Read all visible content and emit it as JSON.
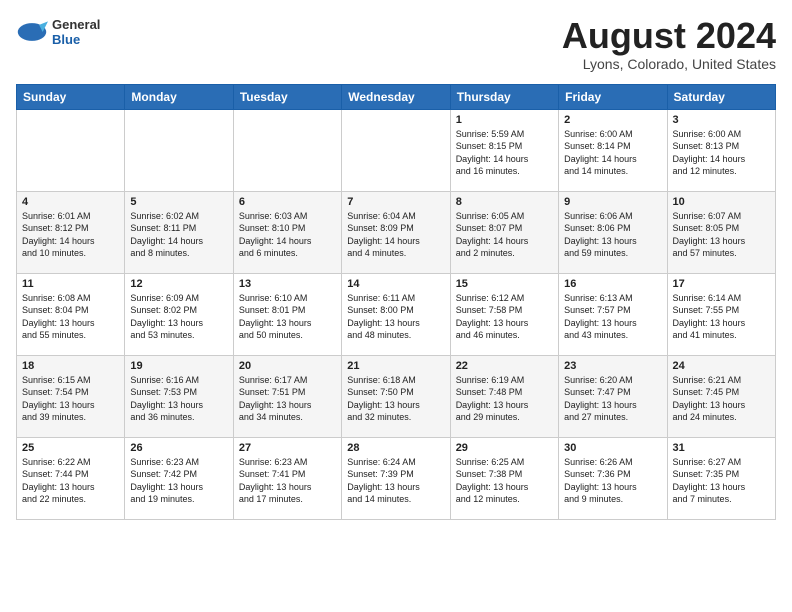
{
  "header": {
    "logo_general": "General",
    "logo_blue": "Blue",
    "month_title": "August 2024",
    "location": "Lyons, Colorado, United States"
  },
  "days_of_week": [
    "Sunday",
    "Monday",
    "Tuesday",
    "Wednesday",
    "Thursday",
    "Friday",
    "Saturday"
  ],
  "weeks": [
    [
      {
        "day": "",
        "info": ""
      },
      {
        "day": "",
        "info": ""
      },
      {
        "day": "",
        "info": ""
      },
      {
        "day": "",
        "info": ""
      },
      {
        "day": "1",
        "info": "Sunrise: 5:59 AM\nSunset: 8:15 PM\nDaylight: 14 hours\nand 16 minutes."
      },
      {
        "day": "2",
        "info": "Sunrise: 6:00 AM\nSunset: 8:14 PM\nDaylight: 14 hours\nand 14 minutes."
      },
      {
        "day": "3",
        "info": "Sunrise: 6:00 AM\nSunset: 8:13 PM\nDaylight: 14 hours\nand 12 minutes."
      }
    ],
    [
      {
        "day": "4",
        "info": "Sunrise: 6:01 AM\nSunset: 8:12 PM\nDaylight: 14 hours\nand 10 minutes."
      },
      {
        "day": "5",
        "info": "Sunrise: 6:02 AM\nSunset: 8:11 PM\nDaylight: 14 hours\nand 8 minutes."
      },
      {
        "day": "6",
        "info": "Sunrise: 6:03 AM\nSunset: 8:10 PM\nDaylight: 14 hours\nand 6 minutes."
      },
      {
        "day": "7",
        "info": "Sunrise: 6:04 AM\nSunset: 8:09 PM\nDaylight: 14 hours\nand 4 minutes."
      },
      {
        "day": "8",
        "info": "Sunrise: 6:05 AM\nSunset: 8:07 PM\nDaylight: 14 hours\nand 2 minutes."
      },
      {
        "day": "9",
        "info": "Sunrise: 6:06 AM\nSunset: 8:06 PM\nDaylight: 13 hours\nand 59 minutes."
      },
      {
        "day": "10",
        "info": "Sunrise: 6:07 AM\nSunset: 8:05 PM\nDaylight: 13 hours\nand 57 minutes."
      }
    ],
    [
      {
        "day": "11",
        "info": "Sunrise: 6:08 AM\nSunset: 8:04 PM\nDaylight: 13 hours\nand 55 minutes."
      },
      {
        "day": "12",
        "info": "Sunrise: 6:09 AM\nSunset: 8:02 PM\nDaylight: 13 hours\nand 53 minutes."
      },
      {
        "day": "13",
        "info": "Sunrise: 6:10 AM\nSunset: 8:01 PM\nDaylight: 13 hours\nand 50 minutes."
      },
      {
        "day": "14",
        "info": "Sunrise: 6:11 AM\nSunset: 8:00 PM\nDaylight: 13 hours\nand 48 minutes."
      },
      {
        "day": "15",
        "info": "Sunrise: 6:12 AM\nSunset: 7:58 PM\nDaylight: 13 hours\nand 46 minutes."
      },
      {
        "day": "16",
        "info": "Sunrise: 6:13 AM\nSunset: 7:57 PM\nDaylight: 13 hours\nand 43 minutes."
      },
      {
        "day": "17",
        "info": "Sunrise: 6:14 AM\nSunset: 7:55 PM\nDaylight: 13 hours\nand 41 minutes."
      }
    ],
    [
      {
        "day": "18",
        "info": "Sunrise: 6:15 AM\nSunset: 7:54 PM\nDaylight: 13 hours\nand 39 minutes."
      },
      {
        "day": "19",
        "info": "Sunrise: 6:16 AM\nSunset: 7:53 PM\nDaylight: 13 hours\nand 36 minutes."
      },
      {
        "day": "20",
        "info": "Sunrise: 6:17 AM\nSunset: 7:51 PM\nDaylight: 13 hours\nand 34 minutes."
      },
      {
        "day": "21",
        "info": "Sunrise: 6:18 AM\nSunset: 7:50 PM\nDaylight: 13 hours\nand 32 minutes."
      },
      {
        "day": "22",
        "info": "Sunrise: 6:19 AM\nSunset: 7:48 PM\nDaylight: 13 hours\nand 29 minutes."
      },
      {
        "day": "23",
        "info": "Sunrise: 6:20 AM\nSunset: 7:47 PM\nDaylight: 13 hours\nand 27 minutes."
      },
      {
        "day": "24",
        "info": "Sunrise: 6:21 AM\nSunset: 7:45 PM\nDaylight: 13 hours\nand 24 minutes."
      }
    ],
    [
      {
        "day": "25",
        "info": "Sunrise: 6:22 AM\nSunset: 7:44 PM\nDaylight: 13 hours\nand 22 minutes."
      },
      {
        "day": "26",
        "info": "Sunrise: 6:23 AM\nSunset: 7:42 PM\nDaylight: 13 hours\nand 19 minutes."
      },
      {
        "day": "27",
        "info": "Sunrise: 6:23 AM\nSunset: 7:41 PM\nDaylight: 13 hours\nand 17 minutes."
      },
      {
        "day": "28",
        "info": "Sunrise: 6:24 AM\nSunset: 7:39 PM\nDaylight: 13 hours\nand 14 minutes."
      },
      {
        "day": "29",
        "info": "Sunrise: 6:25 AM\nSunset: 7:38 PM\nDaylight: 13 hours\nand 12 minutes."
      },
      {
        "day": "30",
        "info": "Sunrise: 6:26 AM\nSunset: 7:36 PM\nDaylight: 13 hours\nand 9 minutes."
      },
      {
        "day": "31",
        "info": "Sunrise: 6:27 AM\nSunset: 7:35 PM\nDaylight: 13 hours\nand 7 minutes."
      }
    ]
  ]
}
